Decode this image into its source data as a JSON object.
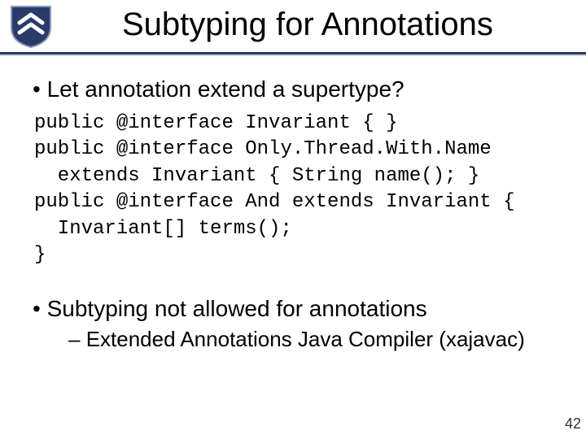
{
  "title": "Subtyping for Annotations",
  "bullets": {
    "b1": "Let annotation extend a supertype?",
    "b2": "Subtyping not allowed for annotations",
    "sub1": "Extended Annotations Java Compiler (xajavac)"
  },
  "code": {
    "l1": "public @interface Invariant { }",
    "l2": "public @interface Only.Thread.With.Name",
    "l3": "  extends Invariant { String name(); }",
    "l4": "public @interface And extends Invariant {",
    "l5": "  Invariant[] terms();",
    "l6": "}"
  },
  "page_number": "42",
  "logo": {
    "bg": "#2a3b6a",
    "chevron": "#ffffff"
  }
}
